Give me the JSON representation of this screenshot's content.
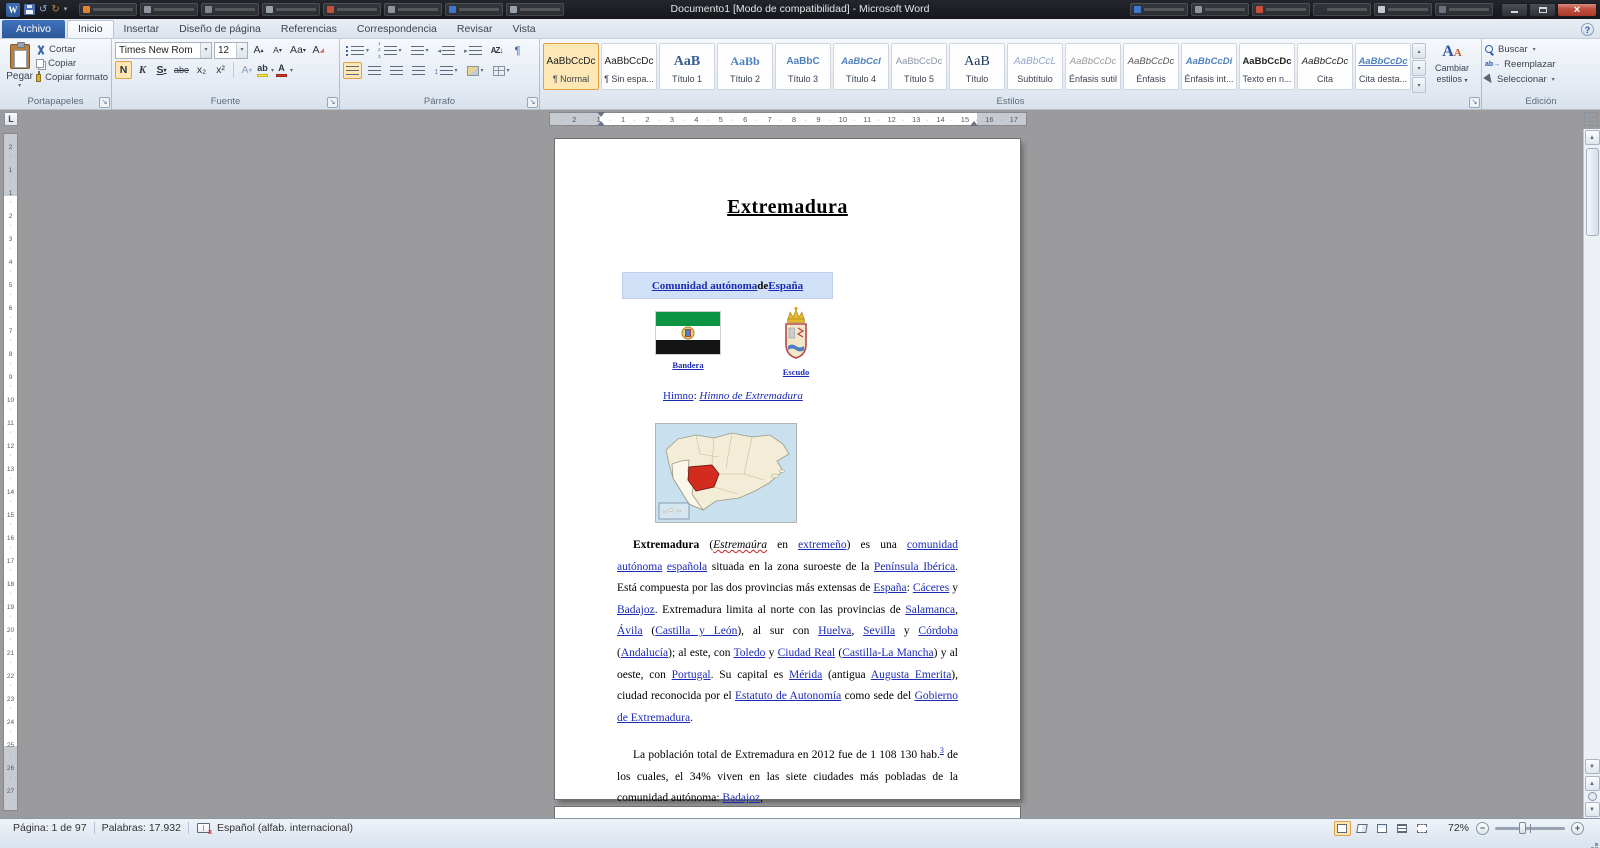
{
  "titlebar": {
    "title": "Documento1 [Modo de compatibilidad] - Microsoft Word",
    "left_tabs": [
      "#e2842f",
      "#8e959e",
      "#7f8790",
      "#99a1aa",
      "#c94f3a",
      "#8e959e",
      "#3f77cf",
      "#99a1aa"
    ],
    "right_tabs": [
      "#3f77cf",
      "#8e959e",
      "#c94f3a",
      "#2e323a",
      "#c5cad2",
      "#6d737c"
    ]
  },
  "ribbon_tabs": {
    "file": "Archivo",
    "items": [
      {
        "label": "Inicio",
        "active": true
      },
      {
        "label": "Insertar"
      },
      {
        "label": "Diseño de página"
      },
      {
        "label": "Referencias"
      },
      {
        "label": "Correspondencia"
      },
      {
        "label": "Revisar"
      },
      {
        "label": "Vista"
      }
    ]
  },
  "ribbon": {
    "clipboard": {
      "group": "Portapapeles",
      "paste": "Pegar",
      "cut": "Cortar",
      "copy": "Copiar",
      "format_painter": "Copiar formato"
    },
    "font": {
      "group": "Fuente",
      "family": "Times New Rom",
      "size": "12",
      "grow": "A",
      "shrink": "A",
      "case": "Aa",
      "clear": "A",
      "bold": "N",
      "italic": "K",
      "underline": "S",
      "strike": "abe",
      "subscript": "x₂",
      "superscript": "x²",
      "effects": "A",
      "highlight": "ab",
      "color": "A"
    },
    "paragraph": {
      "group": "Párrafo",
      "sort": "AZ↓",
      "pilcrow": "¶"
    },
    "styles": {
      "group": "Estilos",
      "change_line1": "Cambiar",
      "change_line2": "estilos",
      "items": [
        {
          "preview": "AaBbCcDc",
          "name": "¶ Normal",
          "cls": "n1",
          "selected": true
        },
        {
          "preview": "AaBbCcDc",
          "name": "¶ Sin espa...",
          "cls": "n2"
        },
        {
          "preview": "AaB",
          "name": "Título 1",
          "cls": "h1"
        },
        {
          "preview": "AaBb",
          "name": "Título 2",
          "cls": "h2"
        },
        {
          "preview": "AaBbC",
          "name": "Título 3",
          "cls": "h3"
        },
        {
          "preview": "AaBbCcI",
          "name": "Título 4",
          "cls": "h4"
        },
        {
          "preview": "AaBbCcDc",
          "name": "Título 5",
          "cls": "h5"
        },
        {
          "preview": "AaB",
          "name": "Título",
          "cls": "ti"
        },
        {
          "preview": "AaBbCcL",
          "name": "Subtítulo",
          "cls": "sub"
        },
        {
          "preview": "AaBbCcDc",
          "name": "Énfasis sutil",
          "cls": "es"
        },
        {
          "preview": "AaBbCcDc",
          "name": "Énfasis",
          "cls": "en"
        },
        {
          "preview": "AaBbCcDi",
          "name": "Énfasis int...",
          "cls": "ei"
        },
        {
          "preview": "AaBbCcDc",
          "name": "Texto en n...",
          "cls": "tn"
        },
        {
          "preview": "AaBbCcDc",
          "name": "Cita",
          "cls": "ci"
        },
        {
          "preview": "AaBbCcDc",
          "name": "Cita desta...",
          "cls": "cd"
        }
      ]
    },
    "editing": {
      "group": "Edición",
      "items": [
        {
          "label": "Buscar",
          "icon": "find",
          "arrow": true
        },
        {
          "label": "Reemplazar",
          "icon": "replace"
        },
        {
          "label": "Seleccionar",
          "icon": "select",
          "arrow": true
        }
      ]
    }
  },
  "ruler": {
    "h": [
      "2",
      "1",
      "1",
      "2",
      "3",
      "4",
      "5",
      "6",
      "7",
      "8",
      "9",
      "10",
      "11",
      "12",
      "13",
      "14",
      "15",
      "16",
      "17"
    ],
    "v": [
      "2",
      "1",
      "1",
      "2",
      "3",
      "4",
      "5",
      "6",
      "7",
      "8",
      "9",
      "10",
      "11",
      "12",
      "13",
      "14",
      "15",
      "16",
      "17",
      "18",
      "19",
      "20",
      "21",
      "22",
      "23",
      "24",
      "25",
      "26",
      "27"
    ]
  },
  "document": {
    "title": "Extremadura",
    "infobox_header": [
      {
        "t": "Comunidad autónoma",
        "b": true,
        "l": true
      },
      {
        "t": " de ",
        "b": true
      },
      {
        "t": "España",
        "b": true,
        "l": true
      }
    ],
    "flag_label": "Bandera",
    "escudo_label": "Escudo",
    "himno": [
      {
        "t": "Himno",
        "l": true
      },
      {
        "t": ": "
      },
      {
        "t": "Himno de Extremadura",
        "l": true,
        "i": true
      }
    ],
    "para1": [
      {
        "t": "Extremadura",
        "b": true
      },
      {
        "t": " ("
      },
      {
        "t": "Estremaúra",
        "sq": true
      },
      {
        "t": " en "
      },
      {
        "t": "extremeño",
        "l": true
      },
      {
        "t": ") es una "
      },
      {
        "t": "comunidad autónoma",
        "l": true
      },
      {
        "t": " "
      },
      {
        "t": "española",
        "l": true
      },
      {
        "t": " situada en la zona suroeste de la "
      },
      {
        "t": "Península Ibérica",
        "l": true
      },
      {
        "t": ". Está compuesta por las dos provincias más extensas de "
      },
      {
        "t": "España",
        "l": true
      },
      {
        "t": ": "
      },
      {
        "t": "Cáceres",
        "l": true
      },
      {
        "t": " y "
      },
      {
        "t": "Badajoz",
        "l": true
      },
      {
        "t": ". Extremadura limita al norte con las provincias de "
      },
      {
        "t": "Salamanca",
        "l": true
      },
      {
        "t": ", "
      },
      {
        "t": "Ávila",
        "l": true
      },
      {
        "t": " ("
      },
      {
        "t": "Castilla y León",
        "l": true
      },
      {
        "t": "), al sur con "
      },
      {
        "t": "Huelva",
        "l": true
      },
      {
        "t": ", "
      },
      {
        "t": "Sevilla",
        "l": true
      },
      {
        "t": " y "
      },
      {
        "t": "Córdoba",
        "l": true
      },
      {
        "t": " ("
      },
      {
        "t": "Andalucía",
        "l": true
      },
      {
        "t": "); al este, con "
      },
      {
        "t": "Toledo",
        "l": true
      },
      {
        "t": " y "
      },
      {
        "t": "Ciudad Real",
        "l": true
      },
      {
        "t": " ("
      },
      {
        "t": "Castilla-La Mancha",
        "l": true
      },
      {
        "t": ") y al oeste, con "
      },
      {
        "t": "Portugal",
        "l": true
      },
      {
        "t": ". Su capital es "
      },
      {
        "t": "Mérida",
        "l": true
      },
      {
        "t": " (antigua "
      },
      {
        "t": "Augusta Emerita",
        "l": true
      },
      {
        "t": "), ciudad reconocida por el "
      },
      {
        "t": "Estatuto de Autonomía",
        "l": true
      },
      {
        "t": " como sede del "
      },
      {
        "t": "Gobierno de Extremadura",
        "l": true
      },
      {
        "t": "."
      }
    ],
    "para2": [
      {
        "t": "La población total de Extremadura en 2012 fue de 1 108 130 hab."
      },
      {
        "t": "3",
        "l": true,
        "sup": true
      },
      {
        "t": " de los cuales, el 34% viven en las siete ciudades más pobladas de la comunidad autónoma: "
      },
      {
        "t": "Badajoz",
        "l": true
      },
      {
        "t": ","
      }
    ]
  },
  "statusbar": {
    "page": "Página: 1 de 97",
    "words": "Palabras: 17.932",
    "language": "Español (alfab. internacional)",
    "zoom": "72%",
    "zoom_minus": "−",
    "zoom_plus": "+"
  }
}
